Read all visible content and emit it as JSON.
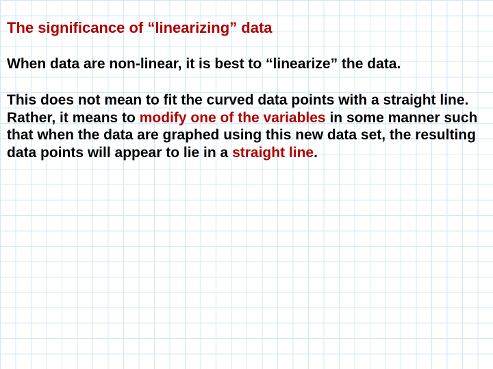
{
  "title": "The significance of “linearizing” data",
  "line1": "When data are non-linear, it is best to “linearize” the data.",
  "para": {
    "p1": "This does not mean to fit the curved data points with a straight line. Rather, it means to ",
    "p2": "modify one of the variables",
    "p3": " in some manner such that when the data are graphed using this new data set, the resulting data points will appear to lie in a ",
    "p4": "straight line",
    "p5": "."
  }
}
